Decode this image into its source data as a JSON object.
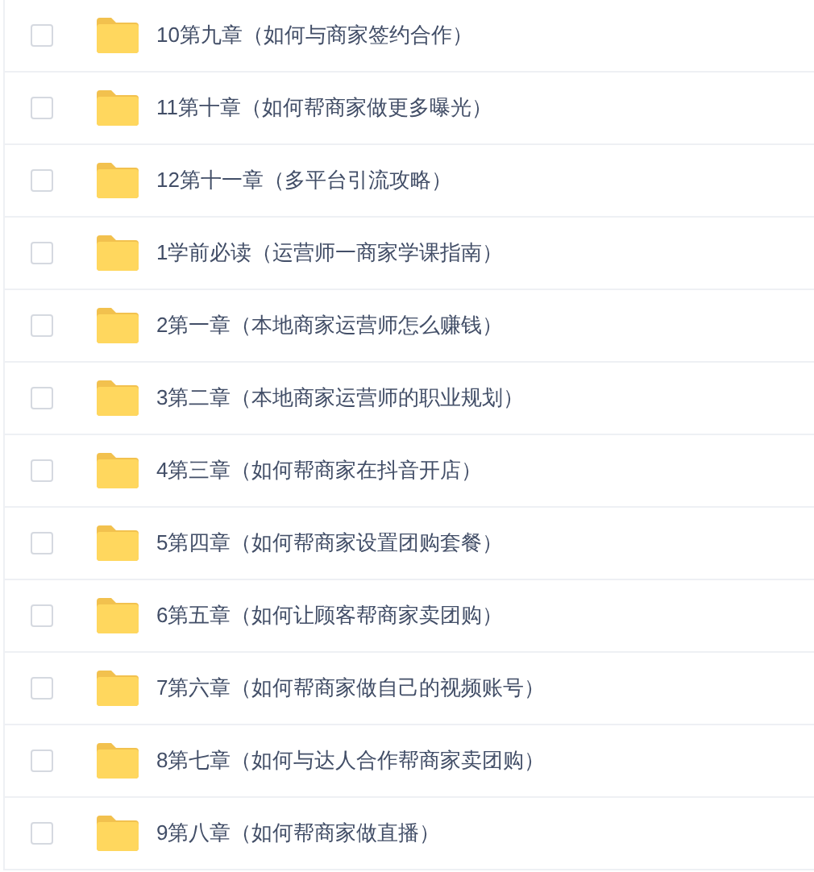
{
  "files": [
    {
      "name": "10第九章（如何与商家签约合作）",
      "checked": false
    },
    {
      "name": "11第十章（如何帮商家做更多曝光）",
      "checked": false
    },
    {
      "name": "12第十一章（多平台引流攻略）",
      "checked": false
    },
    {
      "name": "1学前必读（运营师一商家学课指南）",
      "checked": false
    },
    {
      "name": "2第一章（本地商家运营师怎么赚钱）",
      "checked": false
    },
    {
      "name": "3第二章（本地商家运营师的职业规划）",
      "checked": false
    },
    {
      "name": "4第三章（如何帮商家在抖音开店）",
      "checked": false
    },
    {
      "name": "5第四章（如何帮商家设置团购套餐）",
      "checked": false
    },
    {
      "name": "6第五章（如何让顾客帮商家卖团购）",
      "checked": false
    },
    {
      "name": "7第六章（如何帮商家做自己的视频账号）",
      "checked": false
    },
    {
      "name": "8第七章（如何与达人合作帮商家卖团购）",
      "checked": false
    },
    {
      "name": "9第八章（如何帮商家做直播）",
      "checked": false
    }
  ]
}
